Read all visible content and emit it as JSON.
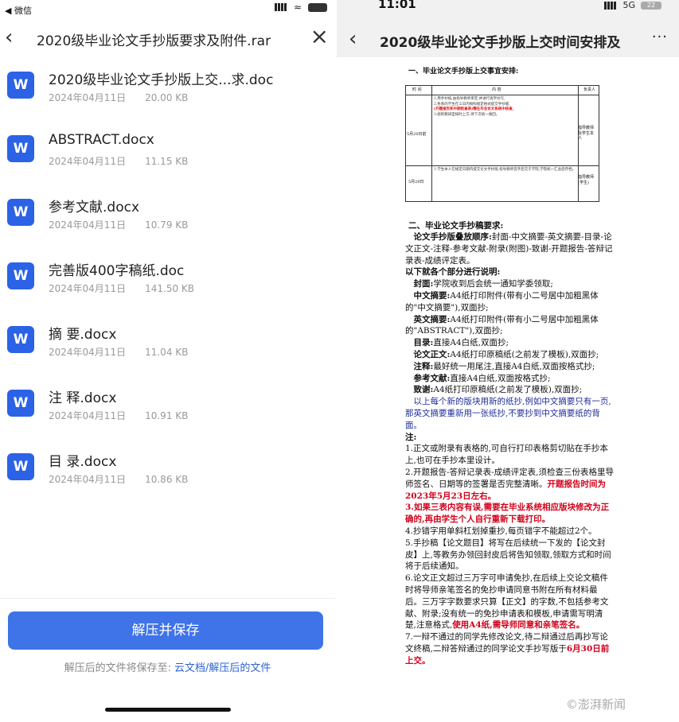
{
  "left": {
    "statusbar": {
      "back_label": "◀ 微信"
    },
    "header": {
      "title": "2020级毕业论文手抄版要求及附件.rar"
    },
    "files": [
      {
        "name": "2020级毕业论文手抄版上交...求.doc",
        "date": "2024年04月11日",
        "size": "20.00 KB",
        "icon": "W"
      },
      {
        "name": "ABSTRACT.docx",
        "date": "2024年04月11日",
        "size": "11.15 KB",
        "icon": "W"
      },
      {
        "name": "参考文献.docx",
        "date": "2024年04月11日",
        "size": "10.79 KB",
        "icon": "W"
      },
      {
        "name": "完善版400字稿纸.doc",
        "date": "2024年04月11日",
        "size": "141.50 KB",
        "icon": "W"
      },
      {
        "name": "摘 要.docx",
        "date": "2024年04月11日",
        "size": "11.04 KB",
        "icon": "W"
      },
      {
        "name": "注 释.docx",
        "date": "2024年04月11日",
        "size": "10.91 KB",
        "icon": "W"
      },
      {
        "name": "目 录.docx",
        "date": "2024年04月11日",
        "size": "10.86 KB",
        "icon": "W"
      }
    ],
    "extract_button": "解压并保存",
    "save_hint": "解压后的文件将保存至:",
    "save_path": "云文档/解压后的文件"
  },
  "right": {
    "statusbar": {
      "time": "11:01",
      "network": "5G",
      "battery": "22"
    },
    "header": {
      "title": "2020级毕业论文手抄版上交时间安排及",
      "more": "···"
    },
    "doc": {
      "section1_title": "一、毕业论文手抄版上交事宜安排:",
      "table": {
        "col1": "时 间",
        "col2": "内    容",
        "col3": "负责人",
        "date1": "5月20日前",
        "date2": "5月29日",
        "cell1a": "1.用手抄纸,由指导教师审定,并进行逐字抄写,",
        "cell1b": "2.各系的学生在三日内按照规定格式提交手抄版,",
        "cell1red": "(开题报告和中期检查表)需在毕业论文系统中核查,",
        "cell1c": "3.组织教研室按时上交,待下次统一收回。",
        "cell2": "1.学生本人在规定日期内提交论文手抄版,指导教师签字后交于学院,学院统一汇总后存档。",
        "person1": "指导教师及学生本人",
        "person2": "指导教师(学生)"
      },
      "section2_title": "二、毕业论文手抄稿要求:",
      "order_label": "论文手抄版叠放顺序:",
      "order_text": "封面-中文摘要-英文摘要-目录-论文正文-注释-参考文献-附录(附图)-致谢-开题报告-答辩记录表-成绩评定表。",
      "intro": "以下就各个部分进行说明:",
      "items": [
        {
          "label": "封面:",
          "text": "学院收到后会统一通知学委领取;"
        },
        {
          "label": "中文摘要:",
          "text": "A4纸打印附件(带有小二号居中加粗黑体的\"中文摘要\"),双面抄;"
        },
        {
          "label": "英文摘要:",
          "text": "A4纸打印附件(带有小二号居中加粗黑体的\"ABSTRACT\"),双面抄;"
        },
        {
          "label": "目录:",
          "text": "直接A4白纸,双面抄;"
        },
        {
          "label": "论文正文:",
          "text": "A4纸打印原稿纸(之前发了模板),双面抄;"
        },
        {
          "label": "注释:",
          "text": "最好统一用尾注,直接A4白纸,双面按格式抄;"
        },
        {
          "label": "参考文献:",
          "text": "直接A4白纸,双面按格式抄;"
        },
        {
          "label": "致谢:",
          "text": "A4纸打印原稿纸(之前发了模板),双面抄;"
        }
      ],
      "blue_note": "以上每个新的版块用新的纸抄,例如中文摘要只有一页,那英文摘要重新用一张纸抄,不要抄到中文摘要纸的背面。",
      "notes_title": "注:",
      "note1": "1.正文或附录有表格的,可自行打印表格剪切贴在手抄本上,也可在手抄本里设计。",
      "note2a": "2.开题报告-答辩记录表-成绩评定表,须检查三份表格里导师签名、日期等的签署是否完整清晰。",
      "note2red": "开题报告时间为2023年5月23日左右。",
      "note3": "3.如果三表内容有误,需要在毕业系统相应版块修改为正确的,再由学生个人自行重新下载打印。",
      "note4": "4.抄错字用单斜杠划掉重抄,每页错字不能超过2个。",
      "note5": "5.手抄稿【论文题目】将写在后续统一下发的【论文封皮】上,等教务办领回封皮后将告知领取,领取方式和时间将于后续通知。",
      "note6a": "6.论文正文超过三万字可申请免抄,在后续上交论文稿件时将导师亲笔签名的免抄申请同意书附在所有材料最后。三万字字数要求只算【正文】的字数,不包括参考文献、附录;没有统一的免抄申请表和模板,申请需写明清楚,注意格式,",
      "note6red": "使用A4纸,需导师同意和亲笔签名。",
      "note7a": "7.一辩不通过的同学先修改论文,待二辩通过后再抄写论文终稿,二辩答辩通过的同学论文手抄写版于",
      "note7red": "6月30日前上交。"
    },
    "watermark": "©澎湃新闻"
  }
}
